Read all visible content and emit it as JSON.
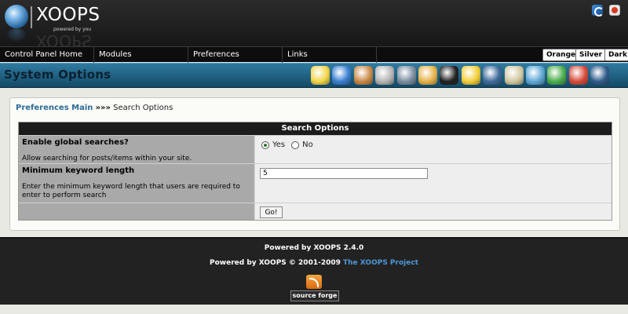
{
  "header": {
    "logo_text": "XOOPS",
    "logo_sub": "powered by you",
    "home_icon": "home-icon",
    "power_icon": "power-icon"
  },
  "nav": {
    "items": [
      "Control Panel Home",
      "Modules",
      "Preferences",
      "Links"
    ],
    "themes": [
      "Orange",
      "Silver",
      "Dark"
    ]
  },
  "modbar": {
    "title": "System Options",
    "icons": [
      {
        "name": "edit-icon",
        "color": "#f2d54a"
      },
      {
        "name": "globe-settings-icon",
        "color": "#3a7fd0"
      },
      {
        "name": "avatar-icon",
        "color": "#c98a48"
      },
      {
        "name": "blocks-icon",
        "color": "#b5b5b5"
      },
      {
        "name": "search-icon",
        "color": "#7a8ea0"
      },
      {
        "name": "user-rank-icon",
        "color": "#e6b34a"
      },
      {
        "name": "star-icon",
        "color": "#222222"
      },
      {
        "name": "smiley-icon",
        "color": "#f3cf3a"
      },
      {
        "name": "monitor-icon",
        "color": "#3f6b9a"
      },
      {
        "name": "mail-icon",
        "color": "#d1c8a1"
      },
      {
        "name": "edit-users-icon",
        "color": "#5fa8d6"
      },
      {
        "name": "groups-icon",
        "color": "#4cae4c"
      },
      {
        "name": "modules-icon",
        "color": "#d64a3a"
      },
      {
        "name": "screen-icon",
        "color": "#2f5b8a"
      }
    ]
  },
  "breadcrumb": {
    "link": "Preferences Main",
    "sep": "»»»",
    "current": "Search Options"
  },
  "form": {
    "title": "Search Options",
    "row1": {
      "label": "Enable global searches?",
      "desc": "Allow searching for posts/items within your site.",
      "yes": "Yes",
      "no": "No"
    },
    "row2": {
      "label": "Minimum keyword length",
      "desc": "Enter the minimum keyword length that users are required to enter to perform search",
      "value": "5"
    },
    "submit_label": "Go!"
  },
  "footer": {
    "line1": "Powered by XOOPS 2.4.0",
    "line2_prefix": "Powered by XOOPS © 2001-2009 ",
    "line2_link": "The XOOPS Project",
    "badge": "source forge"
  }
}
